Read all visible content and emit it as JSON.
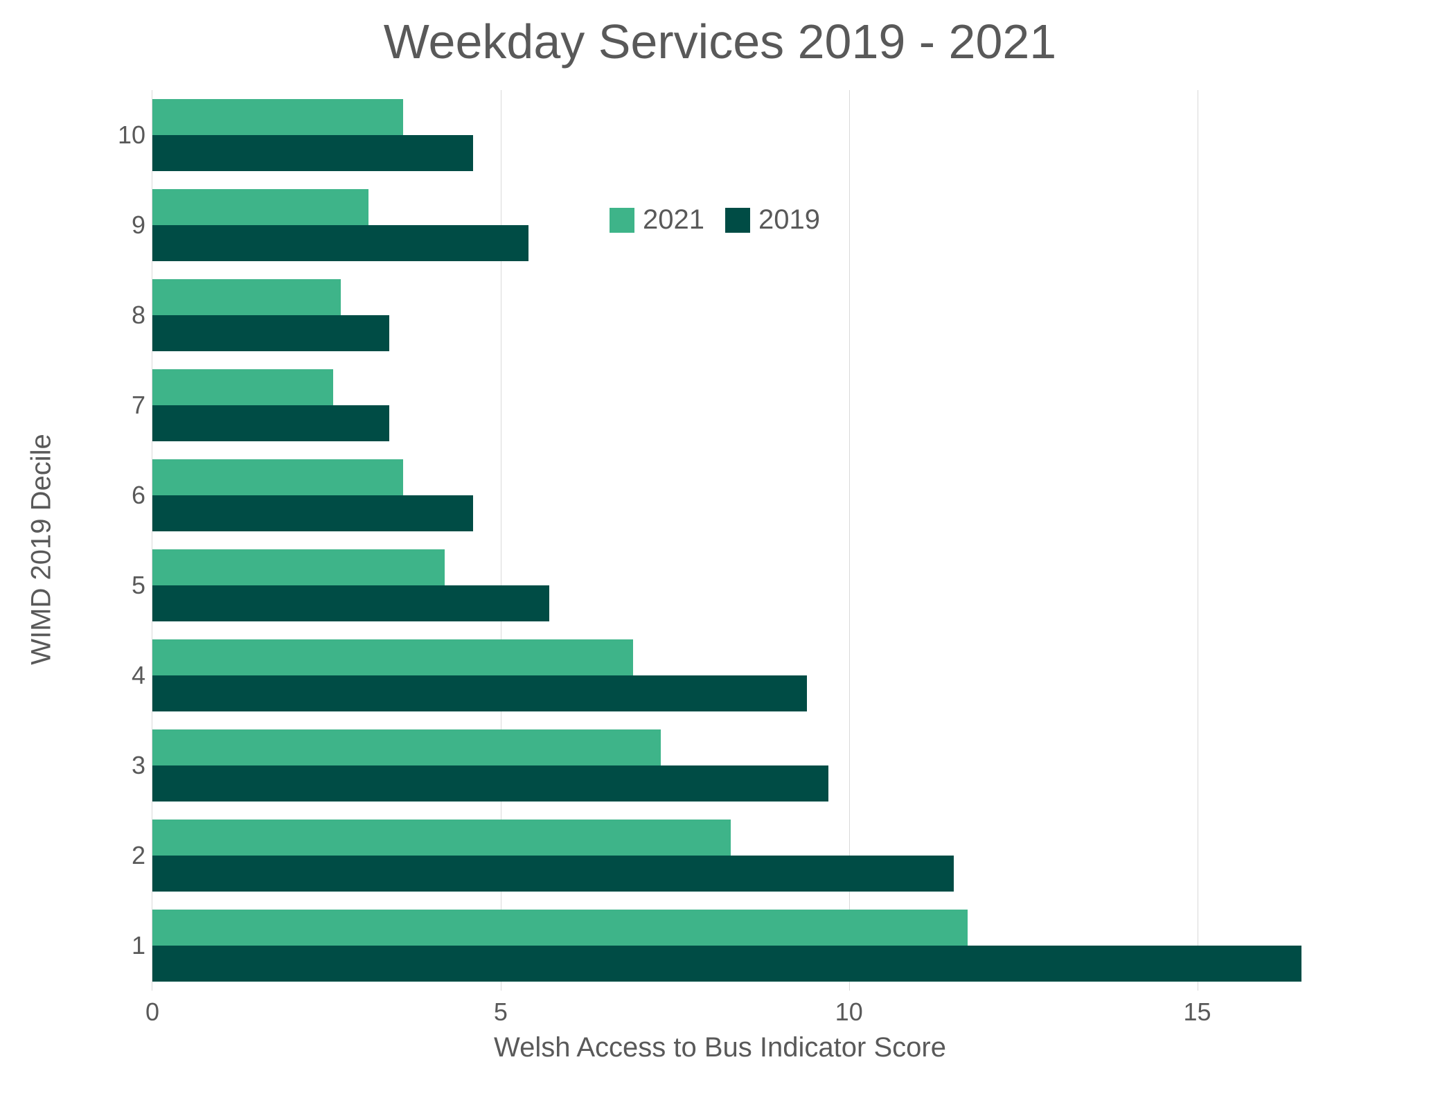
{
  "chart_data": {
    "type": "bar",
    "orientation": "horizontal",
    "title": "Weekday Services 2019 - 2021",
    "xlabel": "Welsh Access to Bus Indicator Score",
    "ylabel": "WIMD 2019 Decile",
    "xlim": [
      0,
      17.5
    ],
    "xticks": [
      0,
      5,
      10,
      15
    ],
    "categories": [
      "10",
      "9",
      "8",
      "7",
      "6",
      "5",
      "4",
      "3",
      "2",
      "1"
    ],
    "series": [
      {
        "name": "2021",
        "color": "#3eb489",
        "values": [
          3.6,
          3.1,
          2.7,
          2.6,
          3.6,
          4.2,
          6.9,
          7.3,
          8.3,
          11.7
        ]
      },
      {
        "name": "2019",
        "color": "#004c45",
        "values": [
          4.6,
          5.4,
          3.4,
          3.4,
          4.6,
          5.7,
          9.4,
          9.7,
          11.5,
          16.5
        ]
      }
    ],
    "legend": {
      "position": "inside-top-right"
    }
  },
  "legend_labels": {
    "s0": "2021",
    "s1": "2019"
  }
}
